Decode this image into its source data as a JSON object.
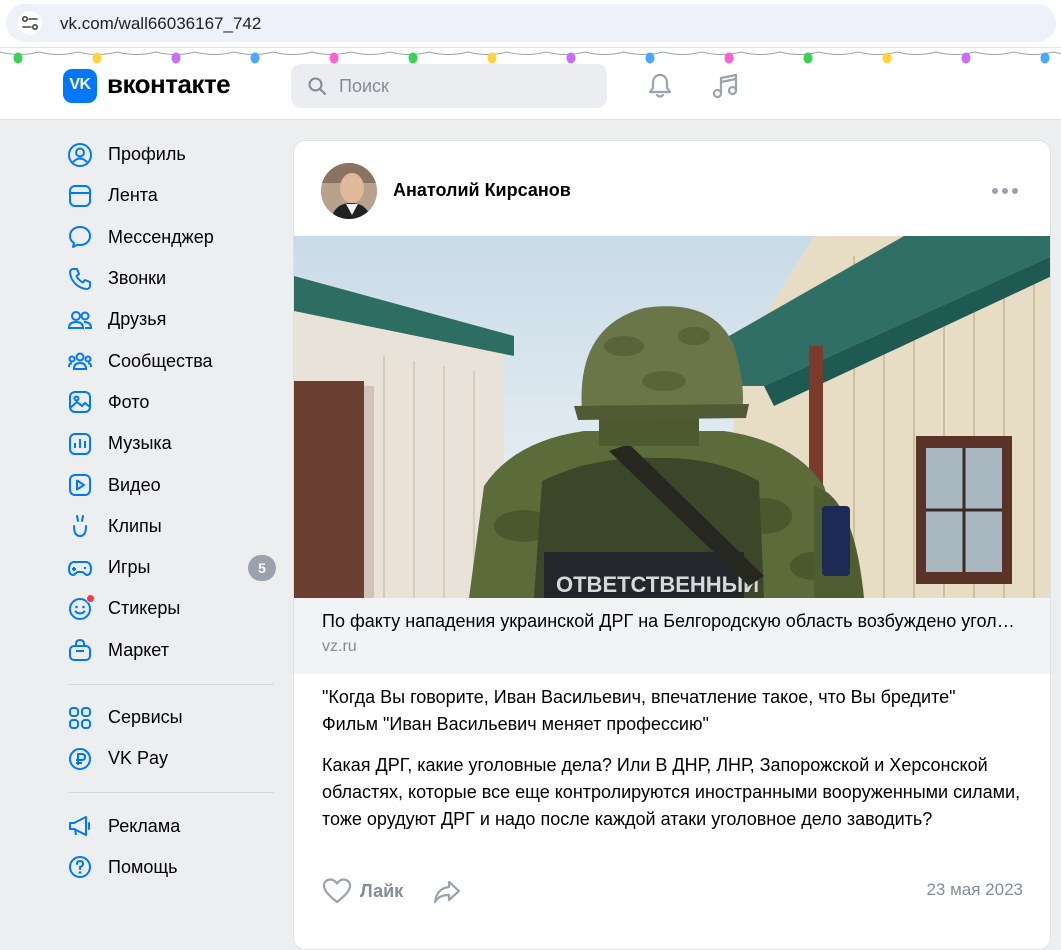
{
  "browser": {
    "url": "vk.com/wall66036167_742"
  },
  "header": {
    "logo_text": "VK",
    "brand": "вконтакте",
    "search_placeholder": "Поиск",
    "accent": "#0077ff"
  },
  "garland_colors": [
    "#39d353",
    "#ffd43b",
    "#c96cff",
    "#4aa8ff",
    "#ff5fd2"
  ],
  "nav": {
    "main": [
      {
        "label": "Профиль",
        "icon": "profile-icon"
      },
      {
        "label": "Лента",
        "icon": "feed-icon"
      },
      {
        "label": "Мессенджер",
        "icon": "messenger-icon"
      },
      {
        "label": "Звонки",
        "icon": "phone-icon"
      },
      {
        "label": "Друзья",
        "icon": "friends-icon"
      },
      {
        "label": "Сообщества",
        "icon": "communities-icon"
      },
      {
        "label": "Фото",
        "icon": "photo-icon"
      },
      {
        "label": "Музыка",
        "icon": "music-icon"
      },
      {
        "label": "Видео",
        "icon": "video-icon"
      },
      {
        "label": "Клипы",
        "icon": "clips-icon"
      },
      {
        "label": "Игры",
        "icon": "games-icon",
        "badge": "5"
      },
      {
        "label": "Стикеры",
        "icon": "stickers-icon"
      },
      {
        "label": "Маркет",
        "icon": "market-icon"
      }
    ],
    "secondary": [
      {
        "label": "Сервисы",
        "icon": "services-icon"
      },
      {
        "label": "VK Pay",
        "icon": "vkpay-icon"
      }
    ],
    "tertiary": [
      {
        "label": "Реклама",
        "icon": "ads-icon"
      },
      {
        "label": "Помощь",
        "icon": "help-icon"
      }
    ]
  },
  "post": {
    "author": "Анатолий Кирсанов",
    "link_title": "По факту нападения украинской ДРГ на Белгородскую область возбуждено уголовное дело",
    "link_domain": "vz.ru",
    "photo_vest_text": "ОТВЕТСТВЕННЫЙ",
    "text_quote_1": "\"Когда Вы говорите, Иван Васильевич, впечатление такое, что Вы бредите\"",
    "text_quote_2": "Фильм \"Иван Васильевич меняет профессию\"",
    "text_body": "Какая ДРГ, какие уголовные дела? Или В ДНР, ЛНР, Запорожской и Херсонской областях, которые все еще контролируются иностранными вооруженными силами, тоже орудуют ДРГ и надо после каждой атаки уголовное дело заводить?",
    "like_label": "Лайк",
    "date": "23 мая 2023"
  }
}
